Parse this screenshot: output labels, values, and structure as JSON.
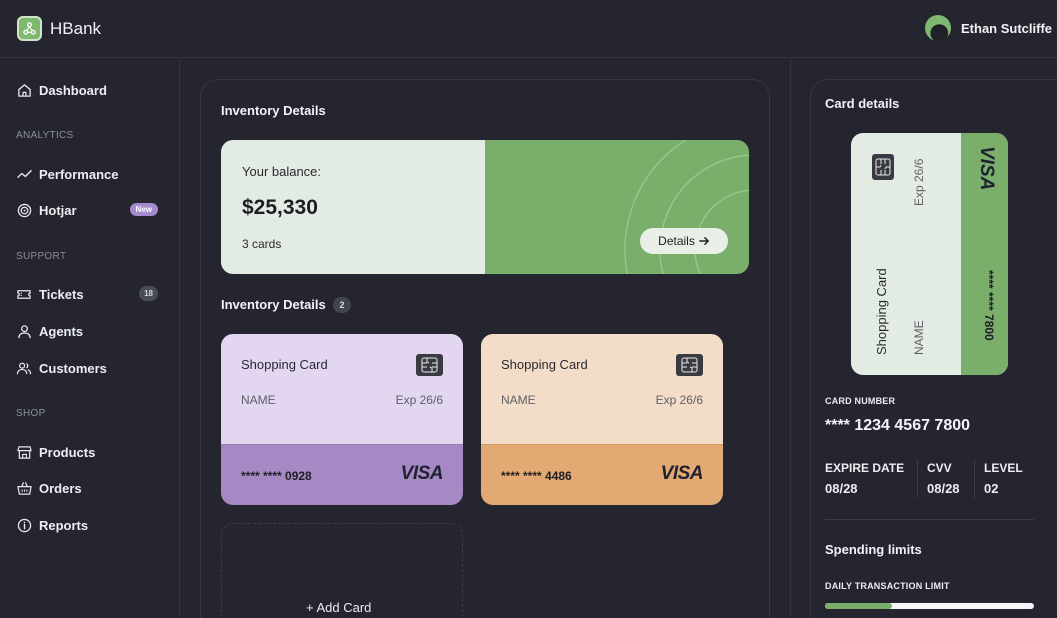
{
  "app": {
    "brand": "HBank"
  },
  "user": {
    "name": "Ethan Sutcliffe"
  },
  "sidebar": {
    "items": [
      {
        "label": "Dashboard"
      },
      {
        "section": "ANALYTICS"
      },
      {
        "label": "Performance"
      },
      {
        "label": "Hotjar",
        "badge": "New"
      },
      {
        "section": "SUPPORT"
      },
      {
        "label": "Tickets",
        "badge": "18"
      },
      {
        "label": "Agents"
      },
      {
        "label": "Customers"
      },
      {
        "section": "SHOP"
      },
      {
        "label": "Products"
      },
      {
        "label": "Orders"
      },
      {
        "label": "Reports"
      }
    ]
  },
  "main": {
    "title": "Inventory Details",
    "balance": {
      "label": "Your balance:",
      "amount": "$25,330",
      "cards": "3 cards",
      "details_button": "Details"
    },
    "cards_section": {
      "title": "Inventory Details",
      "count": "2"
    },
    "cards": [
      {
        "title": "Shopping Card",
        "name": "NAME",
        "exp": "Exp 26/6",
        "number": "**** **** 0928",
        "brand": "VISA",
        "top_color": "#e2d6f1",
        "bottom_color": "#a588c4"
      },
      {
        "title": "Shopping Card",
        "name": "NAME",
        "exp": "Exp 26/6",
        "number": "**** **** 4486",
        "brand": "VISA",
        "top_color": "#f3dcc8",
        "bottom_color": "#e3a972"
      }
    ],
    "add_card": "+ Add Card"
  },
  "details": {
    "title": "Card details",
    "card": {
      "title": "Shopping Card",
      "name": "NAME",
      "exp": "Exp 26/6",
      "number": "**** **** 7800",
      "brand": "VISA"
    },
    "card_number_label": "CARD NUMBER",
    "card_number": "**** 1234 4567 7800",
    "expire_label": "EXPIRE DATE",
    "expire_value": "08/28",
    "cvv_label": "CVV",
    "cvv_value": "08/28",
    "level_label": "LEVEL",
    "level_value": "02",
    "spending_title": "Spending limits",
    "daily_limit_label": "DAILY TRANSACTION LIMIT",
    "daily_limit_fraction": 0.32
  },
  "colors": {
    "accent": "#7aaf6b",
    "background": "#24252e",
    "badge_new": "#a58ad1"
  }
}
